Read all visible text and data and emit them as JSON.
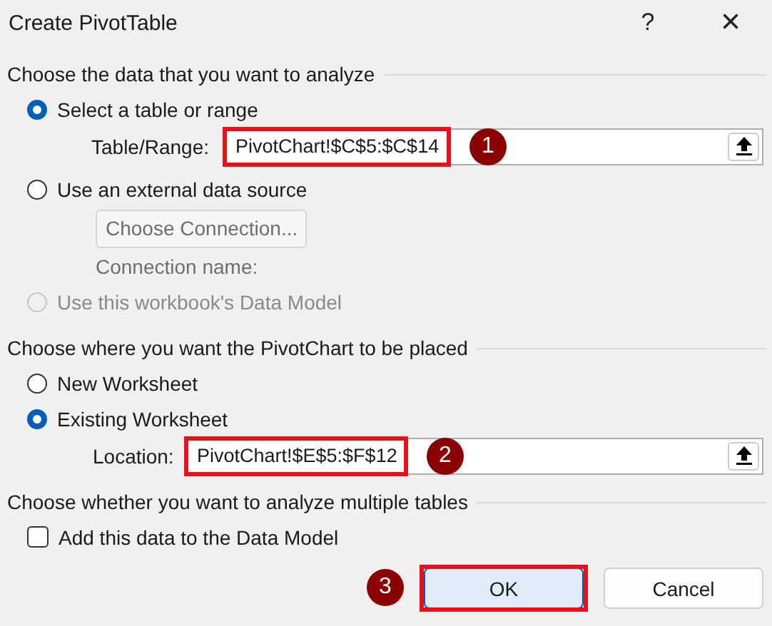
{
  "window": {
    "title": "Create PivotTable",
    "help": "?",
    "close": "×"
  },
  "data_section": {
    "heading": "Choose the data that you want to analyze",
    "options": [
      {
        "kind": "range",
        "label": "Select a table or range",
        "selected": true,
        "disabled": false,
        "field_label": "Table/Range:",
        "value": "PivotChart!$C$5:$C$14"
      },
      {
        "kind": "external",
        "label": "Use an external data source",
        "selected": false,
        "disabled": false,
        "button": {
          "label": "Choose Connection...",
          "disabled": true
        },
        "connection_label": "Connection name:"
      },
      {
        "kind": "plain",
        "label": "Use this workbook's Data Model",
        "selected": false,
        "disabled": true
      }
    ]
  },
  "placement_section": {
    "heading": "Choose where you want the PivotChart to be placed",
    "options": [
      {
        "label": "New Worksheet",
        "selected": false
      },
      {
        "label": "Existing Worksheet",
        "selected": true
      }
    ],
    "location": {
      "label": "Location:",
      "value": "PivotChart!$E$5:$F$12"
    }
  },
  "multiple_section": {
    "heading": "Choose whether you want to analyze multiple tables",
    "checkbox": {
      "label": "Add this data to the Data Model",
      "checked": false
    }
  },
  "buttons": [
    {
      "label": "OK",
      "default": true
    },
    {
      "label": "Cancel",
      "default": false
    }
  ],
  "annotations": [
    {
      "number": "1"
    },
    {
      "number": "2"
    },
    {
      "number": "3"
    }
  ]
}
